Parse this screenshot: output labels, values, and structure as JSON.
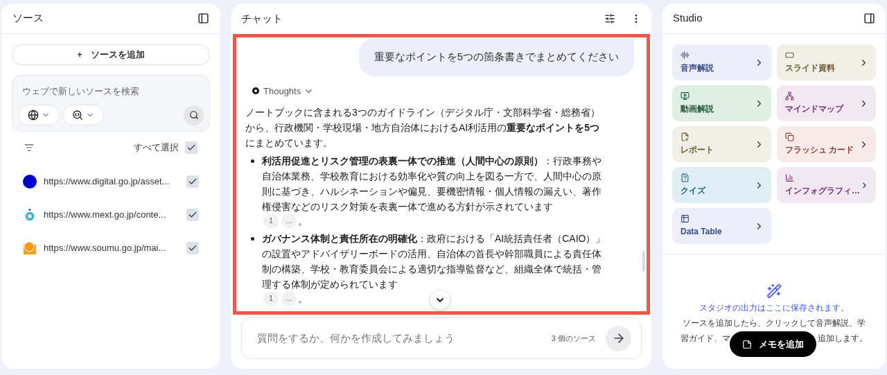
{
  "sources_panel": {
    "title": "ソース",
    "add_button": "ソースを追加",
    "add_icon": "+",
    "search": {
      "placeholder": "ウェブで新しいソースを検索"
    },
    "select_all": {
      "label": "すべて選択",
      "checked": true
    },
    "items": [
      {
        "url": "https://www.digital.go.jp/asset...",
        "checked": true,
        "kind": "dot"
      },
      {
        "url": "https://www.mext.go.jp/conte...",
        "checked": true,
        "kind": "drop"
      },
      {
        "url": "https://www.soumu.go.jp/mai...",
        "checked": true,
        "kind": "square"
      }
    ]
  },
  "chat_panel": {
    "title": "チャット",
    "highlighted": true,
    "user_message": "重要なポイントを5つの箇条書きでまとめてください",
    "thoughts": "Thoughts",
    "intro": "ノートブックに含まれる3つのガイドライン（デジタル庁・文部科学省・総務省）から、行政機関・学校現場・地方自治体におけるAI利活用の**重要なポイントを5つ**にまとめています。",
    "bullets": [
      {
        "text": "**利活用促進とリスク管理の表裏一体での推進（人間中心の原則）**：行政事務や自治体業務、学校教育における効率化や質の向上を図る一方で、人間中心の原則に基づき、ハルシネーションや偏見、要機密情報・個人情報の漏えい、著作権侵害などのリスク対策を表裏一体で進める方針が示されています",
        "citations": [
          "1",
          "…"
        ],
        "end": "。"
      },
      {
        "text": "**ガバナンス体制と責任所在の明確化**：政府における「AI統括責任者（CAIO）」の設置やアドバイザリーボードの活用、自治体の首長や幹部職員による責任体制の構築、学校・教育委員会による適切な指導監督など、組織全体で統括・管理する体制が定められています",
        "citations": [
          "1",
          "…"
        ],
        "end": "。"
      }
    ],
    "input": {
      "placeholder": "質問をするか、何かを作成してみましょう"
    },
    "source_count": "3 個のソース"
  },
  "studio_panel": {
    "title": "Studio",
    "tiles": [
      {
        "label": "音声解説",
        "kind": "audio",
        "color": "#3b4a8c"
      },
      {
        "label": "スライド資料",
        "kind": "slides",
        "color": "#6b5a34"
      },
      {
        "label": "動画解説",
        "kind": "video",
        "color": "#25593a"
      },
      {
        "label": "マインドマップ",
        "kind": "mindmap",
        "color": "#7b2d78"
      },
      {
        "label": "レポート",
        "kind": "report",
        "color": "#6b5a34"
      },
      {
        "label": "フラッシュ カード",
        "kind": "flashcards",
        "color": "#8b3a2e"
      },
      {
        "label": "クイズ",
        "kind": "quiz",
        "color": "#1d5d78"
      },
      {
        "label": "インフォグラフィ…",
        "kind": "infographic",
        "color": "#7b2d78"
      },
      {
        "label": "Data Table",
        "kind": "table",
        "color": "#3b4a8c"
      }
    ],
    "empty_title": "スタジオの出力はここに保存されます。",
    "empty_line_1": "ソースを追加したら、クリックして音声解説、学",
    "empty_line_2_start": "習ガイド、マ",
    "empty_line_2_end": "追加します。",
    "memo_button": "メモを追加"
  }
}
